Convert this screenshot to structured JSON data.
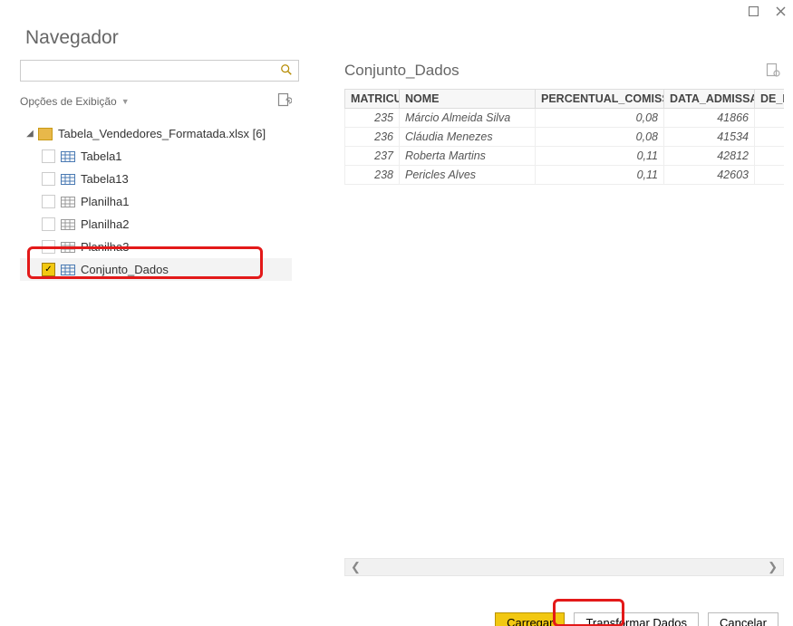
{
  "window": {
    "title": "Navegador"
  },
  "search": {
    "placeholder": ""
  },
  "display_options": {
    "label": "Opções de Exibição"
  },
  "tree": {
    "root": {
      "label": "Tabela_Vendedores_Formatada.xlsx [6]",
      "expanded": true
    },
    "items": [
      {
        "label": "Tabela1",
        "checked": false
      },
      {
        "label": "Tabela13",
        "checked": false
      },
      {
        "label": "Planilha1",
        "checked": false
      },
      {
        "label": "Planilha2",
        "checked": false
      },
      {
        "label": "Planilha3",
        "checked": false
      },
      {
        "label": "Conjunto_Dados",
        "checked": true
      }
    ]
  },
  "preview": {
    "title": "Conjunto_Dados",
    "columns": {
      "c0": "MATRICULA",
      "c1": "NOME",
      "c2": "PERCENTUAL_COMISSAO",
      "c3": "DATA_ADMISSAO",
      "c4": "DE_I"
    },
    "rows": [
      {
        "matricula": "235",
        "nome": "Márcio Almeida Silva",
        "percentual": "0,08",
        "data": "41866"
      },
      {
        "matricula": "236",
        "nome": "Cláudia Menezes",
        "percentual": "0,08",
        "data": "41534"
      },
      {
        "matricula": "237",
        "nome": "Roberta Martins",
        "percentual": "0,11",
        "data": "42812"
      },
      {
        "matricula": "238",
        "nome": "Pericles Alves",
        "percentual": "0,11",
        "data": "42603"
      }
    ]
  },
  "footer": {
    "load": "Carregar",
    "transform": "Transformar Dados",
    "cancel": "Cancelar"
  },
  "icons": {
    "maximize": "maximize-icon",
    "close": "close-icon",
    "search": "search-icon",
    "chevron_down": "chevron-down-icon",
    "refresh": "refresh-icon",
    "caret_down": "caret-down-icon",
    "folder": "folder-icon",
    "table": "table-icon",
    "scroll_left": "scroll-left-icon",
    "scroll_right": "scroll-right-icon"
  }
}
